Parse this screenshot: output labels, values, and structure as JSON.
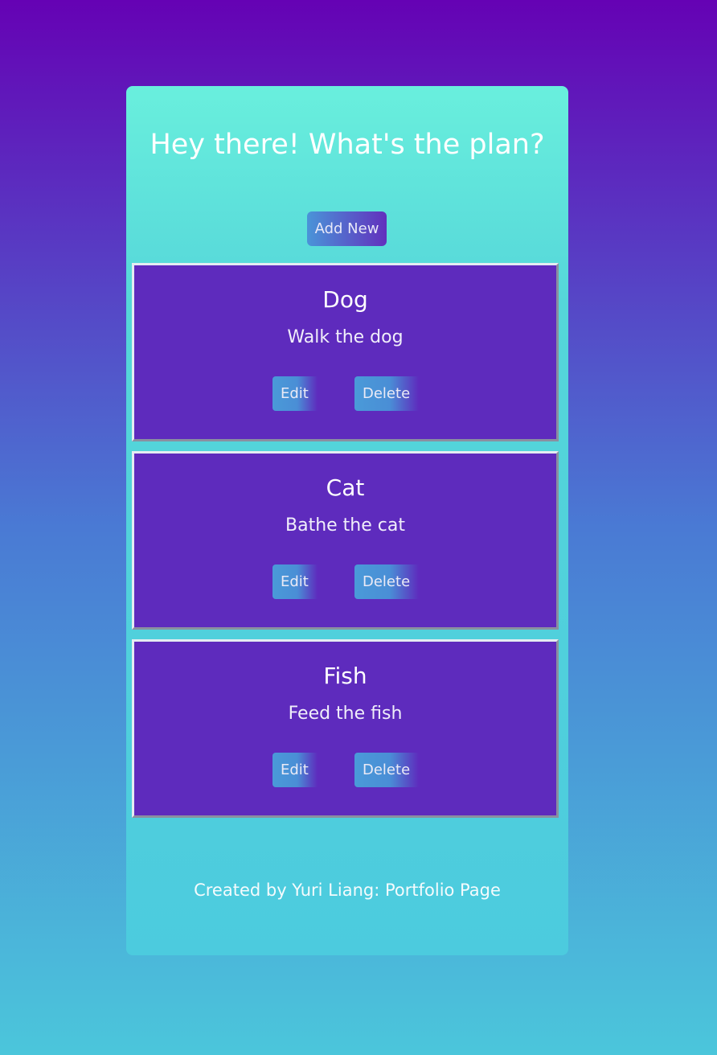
{
  "header": {
    "title": "Hey there! What's the plan?"
  },
  "toolbar": {
    "add_label": "Add New"
  },
  "tasks": [
    {
      "title": "Dog",
      "description": "Walk the dog",
      "edit_label": "Edit",
      "delete_label": "Delete"
    },
    {
      "title": "Cat",
      "description": "Bathe the cat",
      "edit_label": "Edit",
      "delete_label": "Delete"
    },
    {
      "title": "Fish",
      "description": "Feed the fish",
      "edit_label": "Edit",
      "delete_label": "Delete"
    }
  ],
  "footer": {
    "prefix": "Created by Yuri Liang: ",
    "link_label": "Portfolio Page"
  },
  "colors": {
    "background_top": "#6502b4",
    "background_bottom": "#4bc6db",
    "card_top": "#69efdd",
    "card_bottom": "#4ccbde",
    "task_background": "#5e2bbd",
    "button_blue": "#4a94d8"
  }
}
